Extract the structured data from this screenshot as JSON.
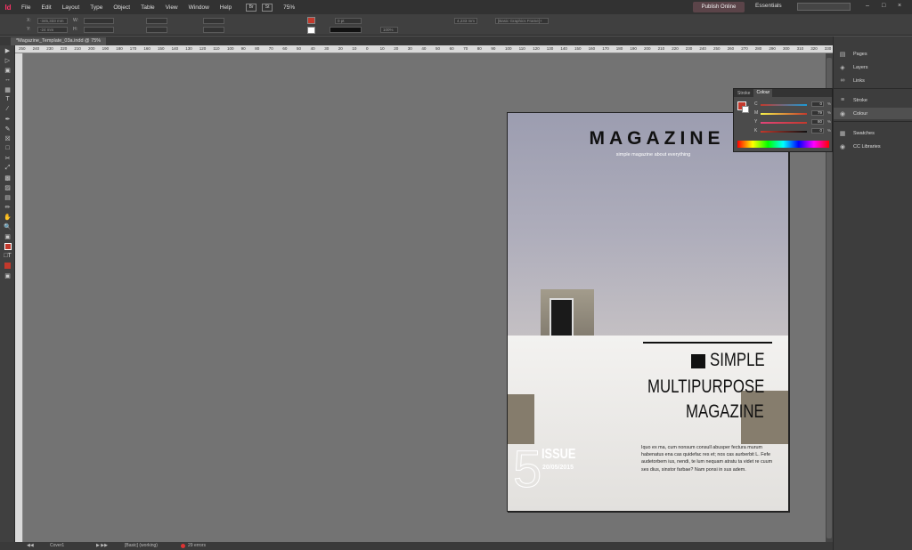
{
  "app": {
    "logo": "Id"
  },
  "menu": [
    "File",
    "Edit",
    "Layout",
    "Type",
    "Object",
    "Table",
    "View",
    "Window",
    "Help"
  ],
  "toolbar_top": {
    "zoom": "75%",
    "publish": "Publish Online",
    "workspace": "Essentials",
    "search_placeholder": ""
  },
  "control": {
    "x_label": "X:",
    "x_value": "-345,333 mm",
    "y_label": "Y:",
    "y_value": "-24 mm",
    "w_label": "W:",
    "h_label": "H:",
    "stroke_weight": "0 pt",
    "opacity": "100%",
    "size_value": "4,233 mm",
    "frame_style": "[Basic Graphics Frame]+"
  },
  "document": {
    "tab_label": "*Magazine_Template_03a.indd @ 75%"
  },
  "ruler": {
    "top_ticks": [
      "250",
      "240",
      "230",
      "220",
      "210",
      "200",
      "190",
      "180",
      "170",
      "160",
      "150",
      "140",
      "130",
      "120",
      "110",
      "100",
      "90",
      "80",
      "70",
      "60",
      "50",
      "40",
      "30",
      "20",
      "10",
      "0",
      "10",
      "20",
      "30",
      "40",
      "50",
      "60",
      "70",
      "80",
      "90",
      "100",
      "110",
      "120",
      "130",
      "140",
      "150",
      "160",
      "170",
      "180",
      "190",
      "200",
      "210",
      "220",
      "230",
      "240",
      "250",
      "260",
      "270",
      "280",
      "290",
      "300",
      "310",
      "320",
      "330"
    ]
  },
  "cover": {
    "title": "MAGAZINE",
    "subtitle": "simple magazine about everything",
    "headline1": "SIMPLE",
    "headline2": "MULTIPURPOSE",
    "headline3": "MAGAZINE",
    "issue_number": "5",
    "issue_word": "ISSUE",
    "issue_date": "20/05/2015",
    "body": "Iquo ex ma, cum nonsum consull abusper fectura murum habenatus ena cas quidefac res et; nos cas aurberbit L. Fefe audetorbem ius, nendi, te lum nequam atratu ta videt re cuum ses dius, sinstor farbae? Nam ponsi in sus adem."
  },
  "panels": {
    "items": [
      "Pages",
      "Layers",
      "Links",
      "Stroke",
      "Colour",
      "Swatches",
      "CC Libraries"
    ],
    "colour_panel": {
      "tabs": [
        "Stroke",
        "Colour"
      ],
      "rows": [
        {
          "label": "C",
          "value": "0"
        },
        {
          "label": "M",
          "value": "79"
        },
        {
          "label": "Y",
          "value": "80"
        },
        {
          "label": "K",
          "value": "0"
        }
      ],
      "pct": "%",
      "fill_color": "#c3392c"
    }
  },
  "status": {
    "page": "Cover1",
    "style": "[Basic] (working)",
    "errors": "29 errors"
  }
}
